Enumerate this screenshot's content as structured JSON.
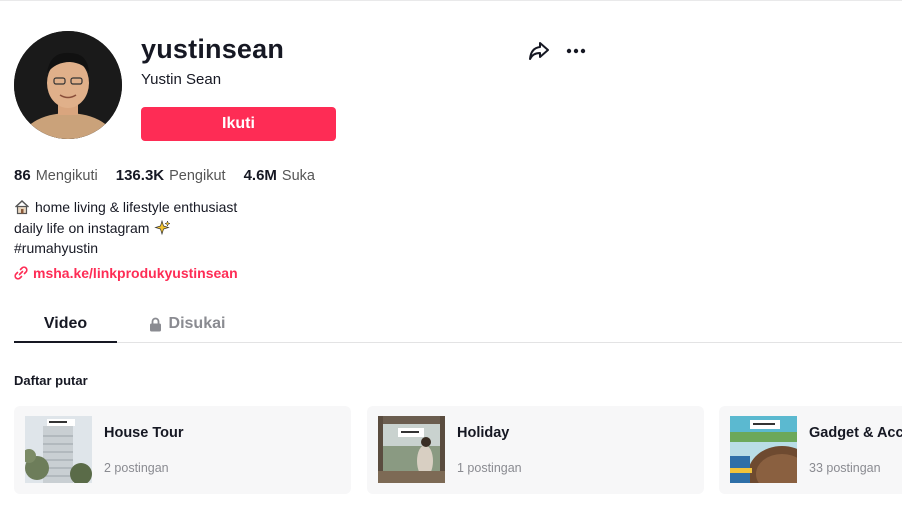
{
  "profile": {
    "username": "yustinsean",
    "nickname": "Yustin Sean",
    "follow_label": "Ikuti"
  },
  "stats": [
    {
      "value": "86",
      "label": "Mengikuti"
    },
    {
      "value": "136.3K",
      "label": "Pengikut"
    },
    {
      "value": "4.6M",
      "label": "Suka"
    }
  ],
  "bio": {
    "line1": "home living & lifestyle enthusiast",
    "line2": "daily life on instagram",
    "line3": "#rumahyustin",
    "icons": [
      "house-emoji-icon",
      "sparkles-emoji-icon"
    ]
  },
  "link": {
    "text": "msha.ke/linkprodukyustinsean",
    "icon": "link-chain-icon"
  },
  "tabs": [
    {
      "label": "Video",
      "active": true
    },
    {
      "label": "Disukai",
      "active": false,
      "icon": "lock-icon"
    }
  ],
  "playlist": {
    "title": "Daftar putar",
    "items": [
      {
        "name": "House Tour",
        "count": "2 postingan"
      },
      {
        "name": "Holiday",
        "count": "1 postingan"
      },
      {
        "name": "Gadget & Acc",
        "count": "33 postingan"
      }
    ]
  },
  "colors": {
    "accent": "#fe2c55",
    "text": "#161823",
    "muted": "#8a8b91",
    "card_bg": "#f7f7f8"
  }
}
